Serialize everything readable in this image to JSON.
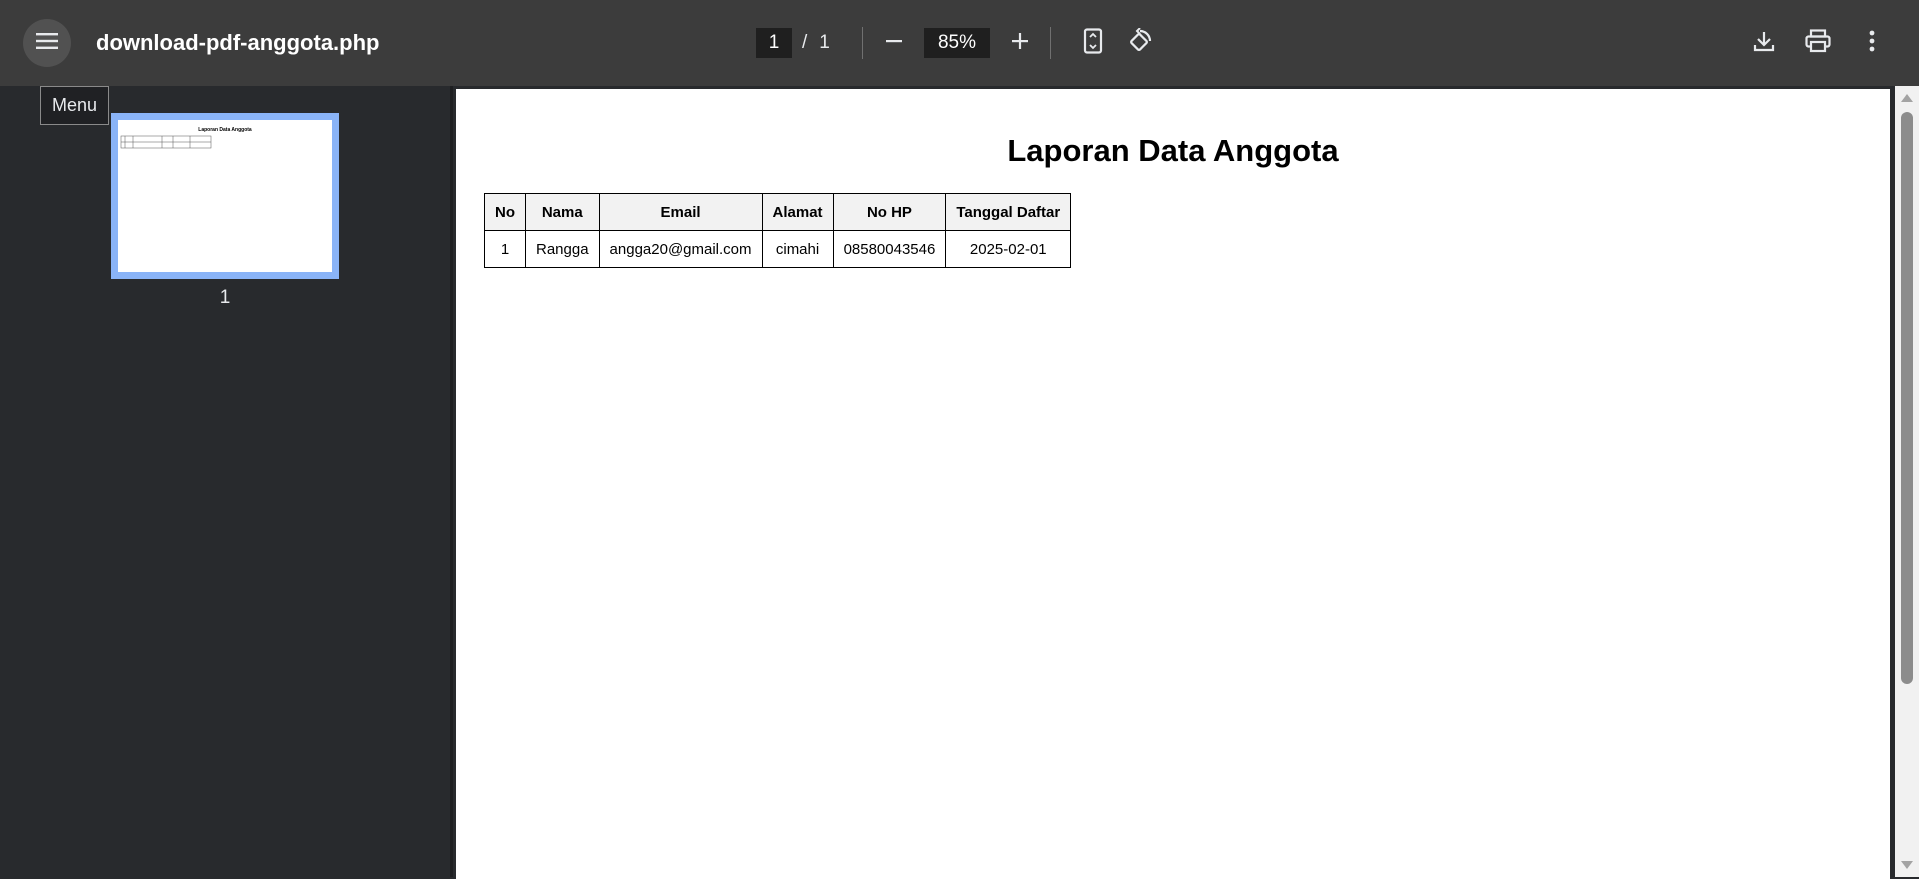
{
  "toolbar": {
    "menu_icon": "hamburger-menu-icon",
    "file_title": "download-pdf-anggota.php",
    "page_current": "1",
    "page_separator": "/",
    "page_total": "1",
    "zoom_value": "85%",
    "icons": {
      "zoom_out": "minus-icon",
      "zoom_in": "plus-icon",
      "fit_page": "fit-to-page-icon",
      "rotate": "rotate-counterclockwise-icon",
      "download": "download-icon",
      "print": "print-icon",
      "more": "more-vertical-icon"
    }
  },
  "sidebar": {
    "tooltip": "Menu",
    "thumbnails": [
      {
        "label": "1",
        "selected": true
      }
    ]
  },
  "document": {
    "title": "Laporan Data Anggota",
    "table": {
      "headers": [
        "No",
        "Nama",
        "Email",
        "Alamat",
        "No HP",
        "Tanggal Daftar"
      ],
      "rows": [
        [
          "1",
          "Rangga",
          "angga20@gmail.com",
          "cimahi",
          "08580043546",
          "2025-02-01"
        ]
      ]
    }
  },
  "colors": {
    "toolbar_bg": "#3c3c3c",
    "viewer_bg": "#282a2d",
    "thumbnail_selected": "#8ab4f8",
    "page_bg": "#ffffff",
    "table_header_bg": "#f2f2f2"
  }
}
